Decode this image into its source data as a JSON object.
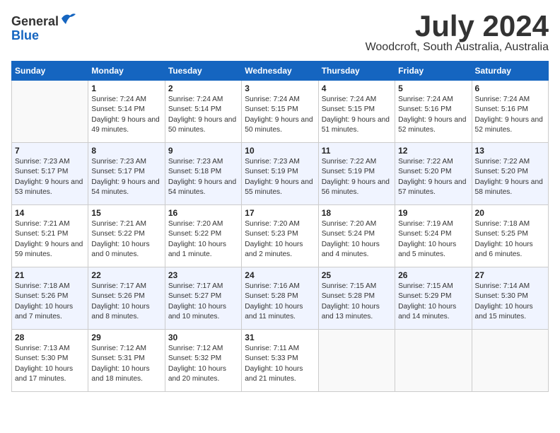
{
  "header": {
    "logo_line1": "General",
    "logo_line2": "Blue",
    "month_title": "July 2024",
    "location": "Woodcroft, South Australia, Australia"
  },
  "weekdays": [
    "Sunday",
    "Monday",
    "Tuesday",
    "Wednesday",
    "Thursday",
    "Friday",
    "Saturday"
  ],
  "weeks": [
    [
      {
        "day": "",
        "sunrise": "",
        "sunset": "",
        "daylight": ""
      },
      {
        "day": "1",
        "sunrise": "7:24 AM",
        "sunset": "5:14 PM",
        "daylight": "9 hours and 49 minutes."
      },
      {
        "day": "2",
        "sunrise": "7:24 AM",
        "sunset": "5:14 PM",
        "daylight": "9 hours and 50 minutes."
      },
      {
        "day": "3",
        "sunrise": "7:24 AM",
        "sunset": "5:15 PM",
        "daylight": "9 hours and 50 minutes."
      },
      {
        "day": "4",
        "sunrise": "7:24 AM",
        "sunset": "5:15 PM",
        "daylight": "9 hours and 51 minutes."
      },
      {
        "day": "5",
        "sunrise": "7:24 AM",
        "sunset": "5:16 PM",
        "daylight": "9 hours and 52 minutes."
      },
      {
        "day": "6",
        "sunrise": "7:24 AM",
        "sunset": "5:16 PM",
        "daylight": "9 hours and 52 minutes."
      }
    ],
    [
      {
        "day": "7",
        "sunrise": "7:23 AM",
        "sunset": "5:17 PM",
        "daylight": "9 hours and 53 minutes."
      },
      {
        "day": "8",
        "sunrise": "7:23 AM",
        "sunset": "5:17 PM",
        "daylight": "9 hours and 54 minutes."
      },
      {
        "day": "9",
        "sunrise": "7:23 AM",
        "sunset": "5:18 PM",
        "daylight": "9 hours and 54 minutes."
      },
      {
        "day": "10",
        "sunrise": "7:23 AM",
        "sunset": "5:19 PM",
        "daylight": "9 hours and 55 minutes."
      },
      {
        "day": "11",
        "sunrise": "7:22 AM",
        "sunset": "5:19 PM",
        "daylight": "9 hours and 56 minutes."
      },
      {
        "day": "12",
        "sunrise": "7:22 AM",
        "sunset": "5:20 PM",
        "daylight": "9 hours and 57 minutes."
      },
      {
        "day": "13",
        "sunrise": "7:22 AM",
        "sunset": "5:20 PM",
        "daylight": "9 hours and 58 minutes."
      }
    ],
    [
      {
        "day": "14",
        "sunrise": "7:21 AM",
        "sunset": "5:21 PM",
        "daylight": "9 hours and 59 minutes."
      },
      {
        "day": "15",
        "sunrise": "7:21 AM",
        "sunset": "5:22 PM",
        "daylight": "10 hours and 0 minutes."
      },
      {
        "day": "16",
        "sunrise": "7:20 AM",
        "sunset": "5:22 PM",
        "daylight": "10 hours and 1 minute."
      },
      {
        "day": "17",
        "sunrise": "7:20 AM",
        "sunset": "5:23 PM",
        "daylight": "10 hours and 2 minutes."
      },
      {
        "day": "18",
        "sunrise": "7:20 AM",
        "sunset": "5:24 PM",
        "daylight": "10 hours and 4 minutes."
      },
      {
        "day": "19",
        "sunrise": "7:19 AM",
        "sunset": "5:24 PM",
        "daylight": "10 hours and 5 minutes."
      },
      {
        "day": "20",
        "sunrise": "7:18 AM",
        "sunset": "5:25 PM",
        "daylight": "10 hours and 6 minutes."
      }
    ],
    [
      {
        "day": "21",
        "sunrise": "7:18 AM",
        "sunset": "5:26 PM",
        "daylight": "10 hours and 7 minutes."
      },
      {
        "day": "22",
        "sunrise": "7:17 AM",
        "sunset": "5:26 PM",
        "daylight": "10 hours and 8 minutes."
      },
      {
        "day": "23",
        "sunrise": "7:17 AM",
        "sunset": "5:27 PM",
        "daylight": "10 hours and 10 minutes."
      },
      {
        "day": "24",
        "sunrise": "7:16 AM",
        "sunset": "5:28 PM",
        "daylight": "10 hours and 11 minutes."
      },
      {
        "day": "25",
        "sunrise": "7:15 AM",
        "sunset": "5:28 PM",
        "daylight": "10 hours and 13 minutes."
      },
      {
        "day": "26",
        "sunrise": "7:15 AM",
        "sunset": "5:29 PM",
        "daylight": "10 hours and 14 minutes."
      },
      {
        "day": "27",
        "sunrise": "7:14 AM",
        "sunset": "5:30 PM",
        "daylight": "10 hours and 15 minutes."
      }
    ],
    [
      {
        "day": "28",
        "sunrise": "7:13 AM",
        "sunset": "5:30 PM",
        "daylight": "10 hours and 17 minutes."
      },
      {
        "day": "29",
        "sunrise": "7:12 AM",
        "sunset": "5:31 PM",
        "daylight": "10 hours and 18 minutes."
      },
      {
        "day": "30",
        "sunrise": "7:12 AM",
        "sunset": "5:32 PM",
        "daylight": "10 hours and 20 minutes."
      },
      {
        "day": "31",
        "sunrise": "7:11 AM",
        "sunset": "5:33 PM",
        "daylight": "10 hours and 21 minutes."
      },
      {
        "day": "",
        "sunrise": "",
        "sunset": "",
        "daylight": ""
      },
      {
        "day": "",
        "sunrise": "",
        "sunset": "",
        "daylight": ""
      },
      {
        "day": "",
        "sunrise": "",
        "sunset": "",
        "daylight": ""
      }
    ]
  ],
  "labels": {
    "sunrise_prefix": "Sunrise: ",
    "sunset_prefix": "Sunset: ",
    "daylight_prefix": "Daylight: "
  }
}
